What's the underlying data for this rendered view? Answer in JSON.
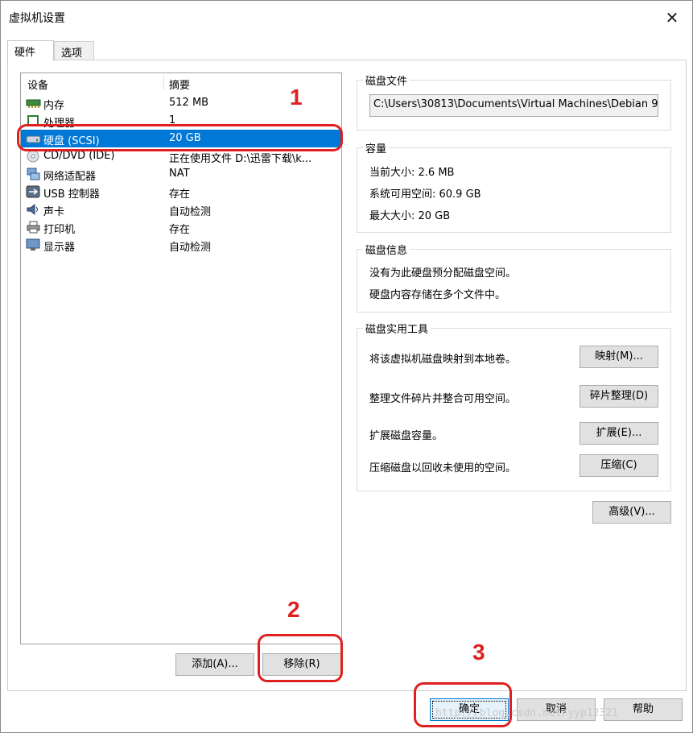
{
  "window": {
    "title": "虚拟机设置"
  },
  "tabs": [
    {
      "label": "硬件"
    },
    {
      "label": "选项"
    }
  ],
  "device_list": {
    "col_device": "设备",
    "col_summary": "摘要",
    "rows": [
      {
        "device": "内存",
        "summary": "512 MB",
        "icon": "memory-icon"
      },
      {
        "device": "处理器",
        "summary": "1",
        "icon": "processor-icon"
      },
      {
        "device": "硬盘 (SCSI)",
        "summary": "20 GB",
        "icon": "harddisk-icon"
      },
      {
        "device": "CD/DVD (IDE)",
        "summary": "正在使用文件 D:\\迅雷下载\\k...",
        "icon": "cdrom-icon"
      },
      {
        "device": "网络适配器",
        "summary": "NAT",
        "icon": "network-icon"
      },
      {
        "device": "USB 控制器",
        "summary": "存在",
        "icon": "usb-icon"
      },
      {
        "device": "声卡",
        "summary": "自动检测",
        "icon": "sound-icon"
      },
      {
        "device": "打印机",
        "summary": "存在",
        "icon": "printer-icon"
      },
      {
        "device": "显示器",
        "summary": "自动检测",
        "icon": "display-icon"
      }
    ],
    "selected_index": 2
  },
  "left_buttons": {
    "add": "添加(A)...",
    "remove": "移除(R)"
  },
  "disk_file": {
    "legend": "磁盘文件",
    "path": "C:\\Users\\30813\\Documents\\Virtual Machines\\Debian 9"
  },
  "capacity": {
    "legend": "容量",
    "current": "当前大小: 2.6 MB",
    "available": "系统可用空间: 60.9 GB",
    "max": "最大大小: 20 GB"
  },
  "disk_info": {
    "legend": "磁盘信息",
    "line1": "没有为此硬盘预分配磁盘空间。",
    "line2": "硬盘内容存储在多个文件中。"
  },
  "utilities": {
    "legend": "磁盘实用工具",
    "map_text": "将该虚拟机磁盘映射到本地卷。",
    "map_btn": "映射(M)...",
    "defrag_text": "整理文件碎片并整合可用空间。",
    "defrag_btn": "碎片整理(D)",
    "expand_text": "扩展磁盘容量。",
    "expand_btn": "扩展(E)...",
    "compact_text": "压缩磁盘以回收未使用的空间。",
    "compact_btn": "压缩(C)"
  },
  "advanced_btn": "高级(V)...",
  "footer": {
    "ok": "确定",
    "cancel": "取消",
    "help": "帮助"
  },
  "annotations": {
    "n1": "1",
    "n2": "2",
    "n3": "3",
    "color": "#e02020"
  },
  "watermark": "http://blog.csdn.net/yyp12321",
  "colors": {
    "selection": "#0078d7"
  }
}
